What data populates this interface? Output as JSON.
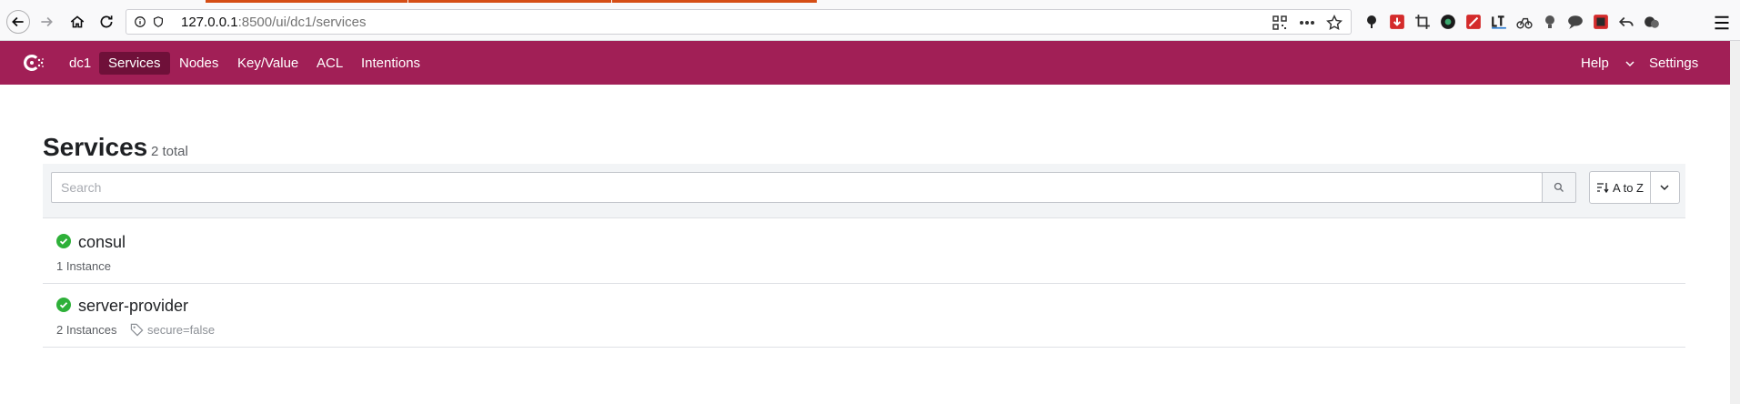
{
  "browser": {
    "url_host": "127.0.0.1",
    "url_path": ":8500/ui/dc1/services"
  },
  "nav": {
    "datacenter": "dc1",
    "items": [
      {
        "label": "Services",
        "active": true
      },
      {
        "label": "Nodes",
        "active": false
      },
      {
        "label": "Key/Value",
        "active": false
      },
      {
        "label": "ACL",
        "active": false
      },
      {
        "label": "Intentions",
        "active": false
      }
    ],
    "help": "Help",
    "settings": "Settings",
    "color": "#a11f56",
    "active_color": "#6f1039"
  },
  "page": {
    "title": "Services",
    "subtitle": "2 total",
    "search_placeholder": "Search",
    "sort_label": "A to Z"
  },
  "services": [
    {
      "name": "consul",
      "instances": "1 Instance",
      "tag": "",
      "status": "passing"
    },
    {
      "name": "server-provider",
      "instances": "2 Instances",
      "tag": "secure=false",
      "status": "passing"
    }
  ],
  "icons": {
    "back": "back-arrow-icon",
    "forward": "forward-arrow-icon",
    "home": "home-icon",
    "reload": "reload-icon",
    "search": "search-icon",
    "status": "check-circle-icon",
    "tag": "tag-icon"
  }
}
